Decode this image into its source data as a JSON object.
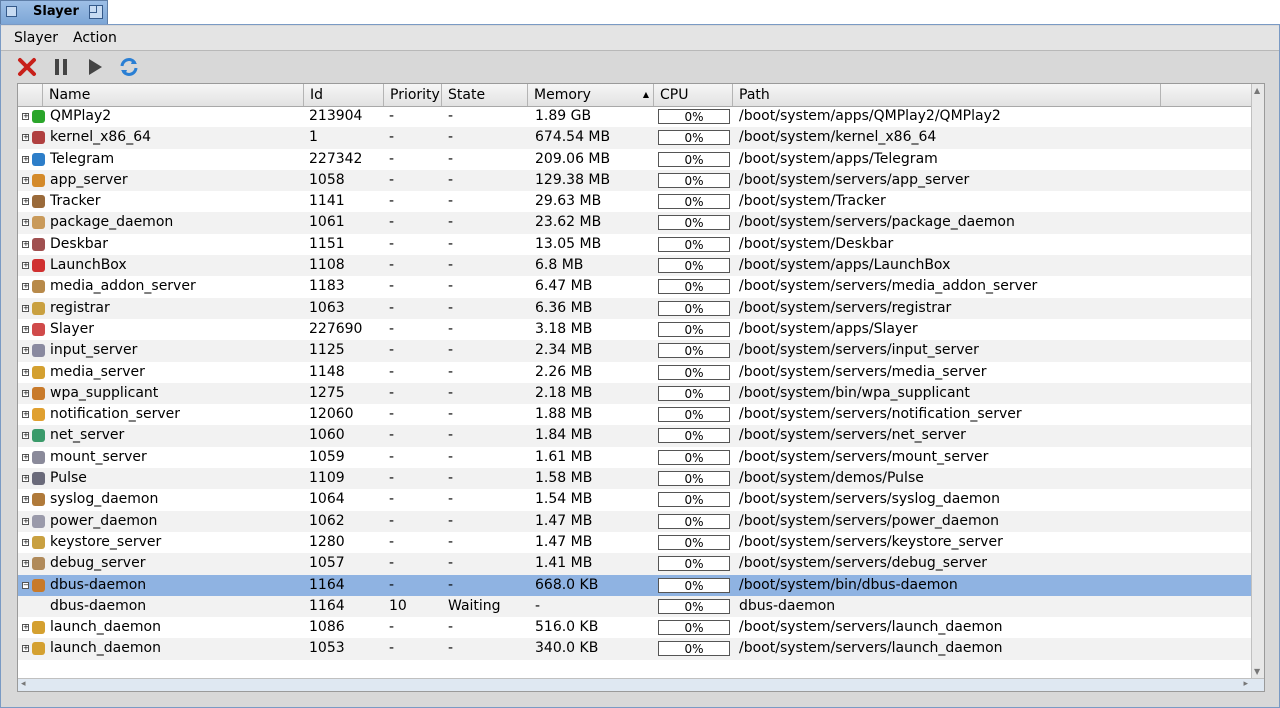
{
  "tab": {
    "title": "Slayer"
  },
  "menubar": {
    "items": [
      "Slayer",
      "Action"
    ]
  },
  "toolbar": {
    "buttons": [
      "kill-icon",
      "pause-icon",
      "play-icon",
      "refresh-icon"
    ]
  },
  "columns": {
    "name": "Name",
    "id": "Id",
    "priority": "Priority",
    "state": "State",
    "memory": "Memory",
    "cpu": "CPU",
    "path": "Path"
  },
  "rows": [
    {
      "name": "QMPlay2",
      "id": "213904",
      "priority": "-",
      "state": "-",
      "memory": "1.89 GB",
      "cpu": "0%",
      "path": "/boot/system/apps/QMPlay2/QMPlay2",
      "icon": "#2aa52a",
      "expander": "+"
    },
    {
      "name": "kernel_x86_64",
      "id": "1",
      "priority": "-",
      "state": "-",
      "memory": "674.54 MB",
      "cpu": "0%",
      "path": "/boot/system/kernel_x86_64",
      "icon": "#b04040",
      "expander": "+"
    },
    {
      "name": "Telegram",
      "id": "227342",
      "priority": "-",
      "state": "-",
      "memory": "209.06 MB",
      "cpu": "0%",
      "path": "/boot/system/apps/Telegram",
      "icon": "#2d7ec9",
      "expander": "+"
    },
    {
      "name": "app_server",
      "id": "1058",
      "priority": "-",
      "state": "-",
      "memory": "129.38 MB",
      "cpu": "0%",
      "path": "/boot/system/servers/app_server",
      "icon": "#d48a2a",
      "expander": "+"
    },
    {
      "name": "Tracker",
      "id": "1141",
      "priority": "-",
      "state": "-",
      "memory": "29.63 MB",
      "cpu": "0%",
      "path": "/boot/system/Tracker",
      "icon": "#9a6a3a",
      "expander": "+"
    },
    {
      "name": "package_daemon",
      "id": "1061",
      "priority": "-",
      "state": "-",
      "memory": "23.62 MB",
      "cpu": "0%",
      "path": "/boot/system/servers/package_daemon",
      "icon": "#c99a5a",
      "expander": "+"
    },
    {
      "name": "Deskbar",
      "id": "1151",
      "priority": "-",
      "state": "-",
      "memory": "13.05 MB",
      "cpu": "0%",
      "path": "/boot/system/Deskbar",
      "icon": "#a05050",
      "expander": "+"
    },
    {
      "name": "LaunchBox",
      "id": "1108",
      "priority": "-",
      "state": "-",
      "memory": "6.8 MB",
      "cpu": "0%",
      "path": "/boot/system/apps/LaunchBox",
      "icon": "#d03030",
      "expander": "+"
    },
    {
      "name": "media_addon_server",
      "id": "1183",
      "priority": "-",
      "state": "-",
      "memory": "6.47 MB",
      "cpu": "0%",
      "path": "/boot/system/servers/media_addon_server",
      "icon": "#b88a4a",
      "expander": "+"
    },
    {
      "name": "registrar",
      "id": "1063",
      "priority": "-",
      "state": "-",
      "memory": "6.36 MB",
      "cpu": "0%",
      "path": "/boot/system/servers/registrar",
      "icon": "#c9a040",
      "expander": "+"
    },
    {
      "name": "Slayer",
      "id": "227690",
      "priority": "-",
      "state": "-",
      "memory": "3.18 MB",
      "cpu": "0%",
      "path": "/boot/system/apps/Slayer",
      "icon": "#d04a4a",
      "expander": "+"
    },
    {
      "name": "input_server",
      "id": "1125",
      "priority": "-",
      "state": "-",
      "memory": "2.34 MB",
      "cpu": "0%",
      "path": "/boot/system/servers/input_server",
      "icon": "#8a8aa0",
      "expander": "+"
    },
    {
      "name": "media_server",
      "id": "1148",
      "priority": "-",
      "state": "-",
      "memory": "2.26 MB",
      "cpu": "0%",
      "path": "/boot/system/servers/media_server",
      "icon": "#d4a030",
      "expander": "+"
    },
    {
      "name": "wpa_supplicant",
      "id": "1275",
      "priority": "-",
      "state": "-",
      "memory": "2.18 MB",
      "cpu": "0%",
      "path": "/boot/system/bin/wpa_supplicant",
      "icon": "#c87a2a",
      "expander": "+"
    },
    {
      "name": "notification_server",
      "id": "12060",
      "priority": "-",
      "state": "-",
      "memory": "1.88 MB",
      "cpu": "0%",
      "path": "/boot/system/servers/notification_server",
      "icon": "#e0a030",
      "expander": "+"
    },
    {
      "name": "net_server",
      "id": "1060",
      "priority": "-",
      "state": "-",
      "memory": "1.84 MB",
      "cpu": "0%",
      "path": "/boot/system/servers/net_server",
      "icon": "#3a9a6a",
      "expander": "+"
    },
    {
      "name": "mount_server",
      "id": "1059",
      "priority": "-",
      "state": "-",
      "memory": "1.61 MB",
      "cpu": "0%",
      "path": "/boot/system/servers/mount_server",
      "icon": "#8a8a9a",
      "expander": "+"
    },
    {
      "name": "Pulse",
      "id": "1109",
      "priority": "-",
      "state": "-",
      "memory": "1.58 MB",
      "cpu": "0%",
      "path": "/boot/system/demos/Pulse",
      "icon": "#6a6a7a",
      "expander": "+"
    },
    {
      "name": "syslog_daemon",
      "id": "1064",
      "priority": "-",
      "state": "-",
      "memory": "1.54 MB",
      "cpu": "0%",
      "path": "/boot/system/servers/syslog_daemon",
      "icon": "#b07a3a",
      "expander": "+"
    },
    {
      "name": "power_daemon",
      "id": "1062",
      "priority": "-",
      "state": "-",
      "memory": "1.47 MB",
      "cpu": "0%",
      "path": "/boot/system/servers/power_daemon",
      "icon": "#9a9aaa",
      "expander": "+"
    },
    {
      "name": "keystore_server",
      "id": "1280",
      "priority": "-",
      "state": "-",
      "memory": "1.47 MB",
      "cpu": "0%",
      "path": "/boot/system/servers/keystore_server",
      "icon": "#c9a040",
      "expander": "+"
    },
    {
      "name": "debug_server",
      "id": "1057",
      "priority": "-",
      "state": "-",
      "memory": "1.41 MB",
      "cpu": "0%",
      "path": "/boot/system/servers/debug_server",
      "icon": "#b08a5a",
      "expander": "+"
    },
    {
      "name": "dbus-daemon",
      "id": "1164",
      "priority": "-",
      "state": "-",
      "memory": "668.0 KB",
      "cpu": "0%",
      "path": "/boot/system/bin/dbus-daemon",
      "icon": "#c87a2a",
      "expander": "−",
      "selected": true
    },
    {
      "name": "dbus-daemon",
      "id": "1164",
      "priority": "10",
      "state": "Waiting",
      "memory": "-",
      "cpu": "0%",
      "path": "dbus-daemon",
      "icon": "",
      "expander": ""
    },
    {
      "name": "launch_daemon",
      "id": "1086",
      "priority": "-",
      "state": "-",
      "memory": "516.0 KB",
      "cpu": "0%",
      "path": "/boot/system/servers/launch_daemon",
      "icon": "#d4a030",
      "expander": "+"
    },
    {
      "name": "launch_daemon",
      "id": "1053",
      "priority": "-",
      "state": "-",
      "memory": "340.0 KB",
      "cpu": "0%",
      "path": "/boot/system/servers/launch_daemon",
      "icon": "#d4a030",
      "expander": "+"
    }
  ],
  "colors": {
    "selection": "#8fb3e2",
    "tab": "#8fb3e2"
  }
}
